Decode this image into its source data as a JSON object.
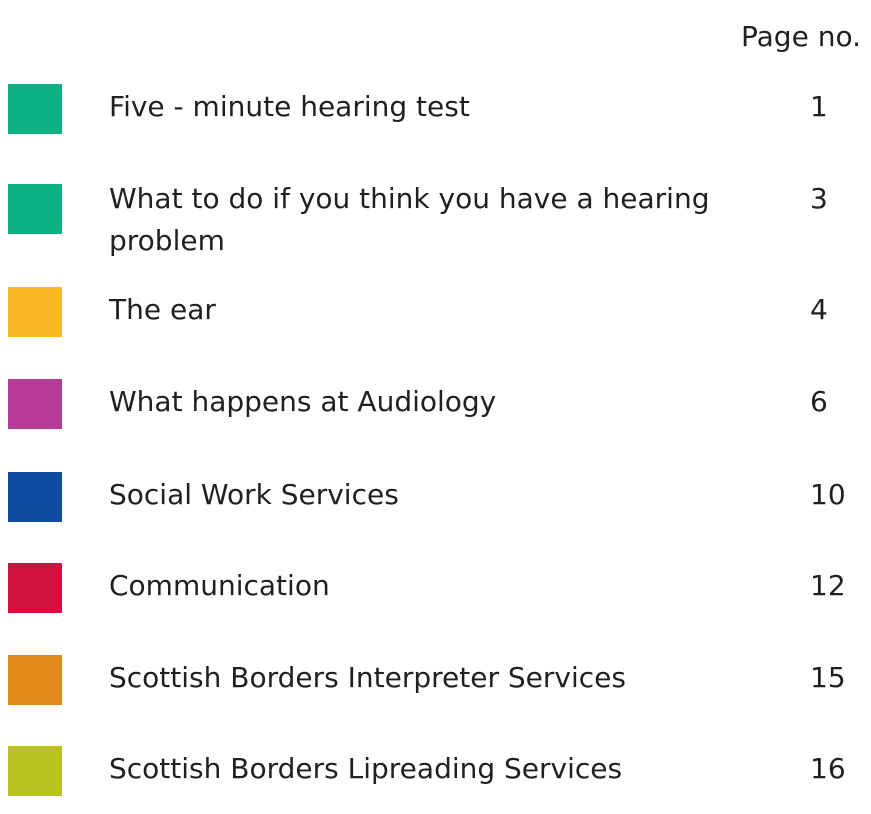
{
  "header": {
    "page_no_label": "Page no."
  },
  "toc": [
    {
      "title": "Five - minute hearing test",
      "page": "1",
      "color": "#0db184"
    },
    {
      "title": "What to do if you think you have a hearing problem",
      "page": "3",
      "color": "#0db184"
    },
    {
      "title": "The ear",
      "page": "4",
      "color": "#fbb827"
    },
    {
      "title": "What happens at Audiology",
      "page": "6",
      "color": "#b63a98"
    },
    {
      "title": "Social Work Services",
      "page": "10",
      "color": "#0f4aa1"
    },
    {
      "title": "Communication",
      "page": "12",
      "color": "#d2113f"
    },
    {
      "title": "Scottish Borders Interpreter Services",
      "page": "15",
      "color": "#e28b1c"
    },
    {
      "title": "Scottish Borders Lipreading Services",
      "page": "16",
      "color": "#b9c21f"
    }
  ]
}
